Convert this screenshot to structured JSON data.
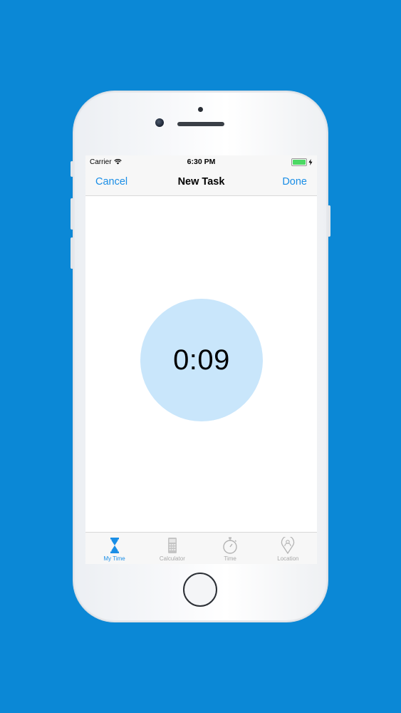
{
  "status_bar": {
    "carrier": "Carrier",
    "time": "6:30 PM"
  },
  "nav": {
    "cancel_label": "Cancel",
    "title": "New Task",
    "done_label": "Done"
  },
  "timer": {
    "display": "0:09"
  },
  "tabs": [
    {
      "label": "My Time",
      "icon": "hourglass-icon",
      "active": true
    },
    {
      "label": "Calculator",
      "icon": "calculator-icon",
      "active": false
    },
    {
      "label": "Time",
      "icon": "stopwatch-icon",
      "active": false
    },
    {
      "label": "Location",
      "icon": "location-pin-icon",
      "active": false
    }
  ],
  "colors": {
    "background": "#0b88d6",
    "accent": "#1a8ee6",
    "timer_circle": "#c9e6fb",
    "battery": "#4cd964"
  }
}
